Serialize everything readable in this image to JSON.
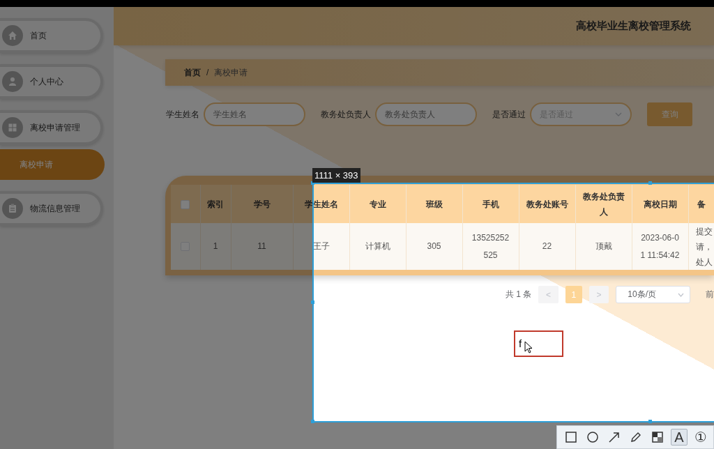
{
  "sidebar": {
    "items": [
      {
        "label": "首页",
        "selected": false
      },
      {
        "label": "个人中心",
        "selected": false
      },
      {
        "label": "离校申请管理",
        "selected": false,
        "children": [
          {
            "label": "离校申请",
            "selected": true
          }
        ]
      },
      {
        "label": "物流信息管理",
        "selected": false
      }
    ]
  },
  "header": {
    "title": "高校毕业生离校管理系统"
  },
  "breadcrumb": {
    "items": [
      "首页",
      "离校申请"
    ],
    "separator": "/"
  },
  "search": {
    "fields": [
      {
        "kind": "input",
        "label": "学生姓名",
        "placeholder": "学生姓名"
      },
      {
        "kind": "input",
        "label": "教务处负责人",
        "placeholder": "教务处负责人"
      },
      {
        "kind": "select",
        "label": "是否通过",
        "placeholder": "是否通过"
      }
    ],
    "button": "查询"
  },
  "table": {
    "header_checked": false,
    "columns": [
      "索引",
      "学号",
      "学生姓名",
      "专业",
      "班级",
      "手机",
      "教务处账号",
      "教务处负责人",
      "离校日期",
      "备"
    ],
    "rows": [
      {
        "checked": false,
        "cells": [
          "1",
          "11",
          "王子",
          "计算机",
          "305",
          "13525252525",
          "22",
          "顶戴",
          "2023-06-01 11:54:42",
          "提交请，处人"
        ]
      }
    ]
  },
  "pagination": {
    "total": "共 1 条",
    "prev": "<",
    "pages": [
      {
        "label": "1",
        "selected": true
      }
    ],
    "next": ">",
    "page_size": "10条/页",
    "goto": "前"
  },
  "capture": {
    "size": "1111 × 393",
    "typed_text": "f",
    "tools": [
      {
        "kind": "icon",
        "selected": false
      },
      {
        "kind": "icon",
        "selected": false
      },
      {
        "kind": "icon",
        "selected": false
      },
      {
        "kind": "icon",
        "selected": false
      },
      {
        "kind": "icon",
        "selected": false
      },
      {
        "kind": "glyph",
        "label": "A",
        "selected": true
      },
      {
        "kind": "glyph",
        "label": "①",
        "selected": false
      }
    ]
  }
}
